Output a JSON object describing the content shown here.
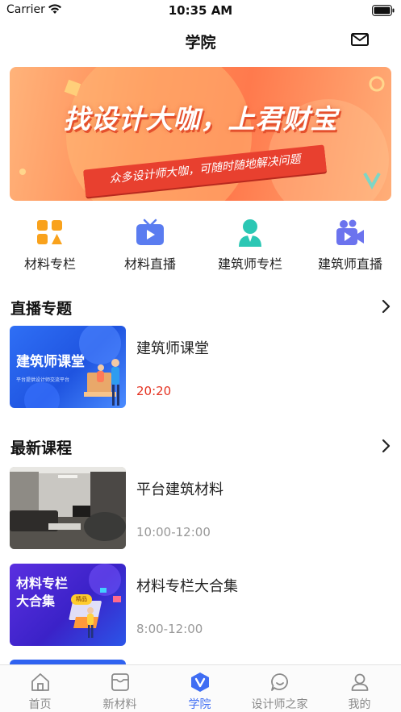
{
  "status_bar": {
    "carrier": "Carrier",
    "time": "10:35 AM"
  },
  "nav": {
    "title": "学院",
    "right_icon": "mail-icon"
  },
  "banner": {
    "headline": "找设计大咖，上君财宝",
    "tagline": "众多设计师大咖，可随时随地解决问题"
  },
  "quick_links": [
    {
      "label": "材料专栏",
      "icon": "grid-icon"
    },
    {
      "label": "材料直播",
      "icon": "tv-icon"
    },
    {
      "label": "建筑师专栏",
      "icon": "person-icon"
    },
    {
      "label": "建筑师直播",
      "icon": "video-camera-icon"
    }
  ],
  "live_section": {
    "title": "直播专题",
    "items": [
      {
        "title": "建筑师课堂",
        "time": "20:20",
        "thumb_title": "建筑师课堂",
        "thumb_sub": "平台提供设计师交流平台"
      }
    ]
  },
  "latest_section": {
    "title": "最新课程",
    "items": [
      {
        "title": "平台建筑材料",
        "time": "10:00-12:00"
      },
      {
        "title": "材料专栏大合集",
        "time": "8:00-12:00",
        "thumb_title": "材料专栏\n大合集",
        "thumb_badge": "精品"
      }
    ]
  },
  "tabs": [
    {
      "label": "首页",
      "icon": "home-icon",
      "active": false
    },
    {
      "label": "新材料",
      "icon": "inbox-icon",
      "active": false
    },
    {
      "label": "学院",
      "icon": "academy-v-icon",
      "active": true
    },
    {
      "label": "设计师之家",
      "icon": "chat-icon",
      "active": false
    },
    {
      "label": "我的",
      "icon": "user-icon",
      "active": false
    }
  ],
  "colors": {
    "accent": "#3f6df3",
    "live_time": "#e53322",
    "banner": "#ff8a55"
  }
}
